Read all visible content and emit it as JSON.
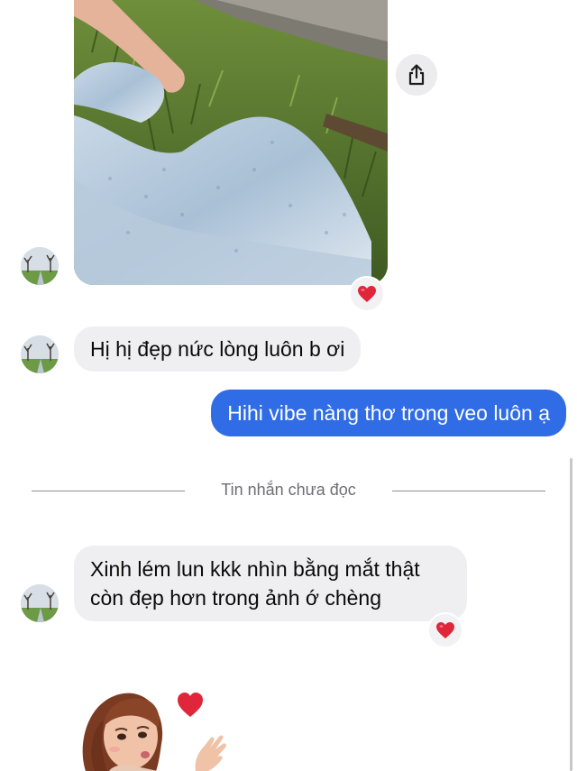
{
  "conversation": {
    "photo_message": {
      "image": "photo-person-lying-on-grass-in-white-fluffy-dress",
      "reaction": "heart"
    },
    "share_button": {
      "icon": "share-icon"
    },
    "messages": [
      {
        "direction": "incoming",
        "text": "Hị hị đẹp nức lòng luôn b ơi"
      },
      {
        "direction": "outgoing",
        "text": "Hihi vibe nàng thơ trong veo luôn ạ"
      }
    ],
    "unread_divider": {
      "label": "Tin nhắn chưa đọc"
    },
    "unread_messages": [
      {
        "direction": "incoming",
        "lines": [
          "Xinh lém lun kkk nhìn bằng mắt thật",
          "còn đẹp hơn trong ảnh ớ chèng"
        ],
        "reaction": "heart"
      }
    ],
    "sticker": {
      "name": "blowing-kiss-avatar-sticker"
    }
  },
  "colors": {
    "outgoing_bubble": "#2f6ce5",
    "incoming_bubble": "#efeff1",
    "heart": "#e0263b"
  }
}
